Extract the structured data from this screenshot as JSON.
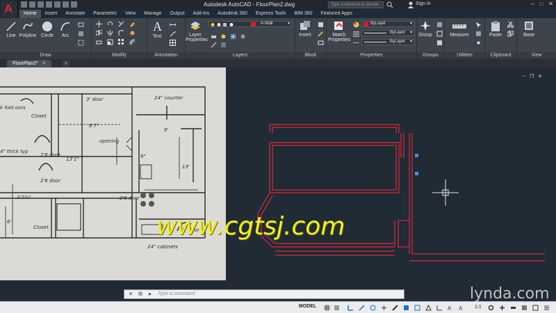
{
  "title_bar": {
    "title": "Autodesk AutoCAD - FloorPlan2.dwg",
    "search_placeholder": "Type a keyword or phrase",
    "sign_in": "Sign In",
    "app_letter": "A"
  },
  "ribbon_tabs": [
    "Home",
    "Insert",
    "Annotate",
    "Parametric",
    "View",
    "Manage",
    "Output",
    "Add-ins",
    "Autodesk 360",
    "Express Tools",
    "BIM 360",
    "Featured Apps"
  ],
  "active_tab": "Home",
  "panels": {
    "draw": {
      "label": "Draw",
      "tools": [
        "Line",
        "Polyline",
        "Circle",
        "Arc"
      ]
    },
    "modify": {
      "label": "Modify"
    },
    "annotation": {
      "label": "Annotation",
      "tools": [
        "Text"
      ]
    },
    "layers": {
      "label": "Layers",
      "tools": [
        "Layer",
        "Properties"
      ],
      "current_layer": "A-Wall"
    },
    "block": {
      "label": "Block",
      "tools": [
        "Insert"
      ]
    },
    "properties": {
      "label": "Properties",
      "tools": [
        "Match",
        "Properties"
      ],
      "color": "ByLayer",
      "linetype": "ByLayer",
      "lineweight": "ByLayer"
    },
    "groups": {
      "label": "Groups",
      "tools": [
        "Group"
      ]
    },
    "utilities": {
      "label": "Utilities",
      "tools": [
        "Measure"
      ]
    },
    "clipboard": {
      "label": "Clipboard",
      "tools": [
        "Paste"
      ]
    },
    "view": {
      "label": "View",
      "tools": [
        "Base"
      ]
    }
  },
  "drawing_tab": {
    "name": "FloorPlan2*"
  },
  "sketch_labels": {
    "closet_top": "Closet",
    "door_3": "3' door",
    "counter": "24\" counter",
    "dim_8_7": "8'7\"",
    "dim_9": "9'",
    "opening": "opening",
    "dim_13_1": "13'1\"",
    "door_26": "2'6 door",
    "door_26b": "2'6 door",
    "door_26c": "2'6 door",
    "thick": "4\" thick typ",
    "dim_13": "13'",
    "dim_9b": "9\"",
    "dim_2": "2'2½\"",
    "dim_6": "6'",
    "closet_bottom": "Closet",
    "door_3b": "3' door",
    "cabinets": "24\" cabinets",
    "side_text": "k\nfold\noors"
  },
  "watermarks": {
    "site": "www.cgtsj.com",
    "lynda": "lynda.com"
  },
  "command_line": {
    "placeholder": "Type a command"
  },
  "status_bar": {
    "model": "MODEL",
    "scale": "1:1"
  },
  "colors": {
    "wall_red": "#e0283a",
    "canvas": "#202b35",
    "accent": "#e01c24"
  }
}
